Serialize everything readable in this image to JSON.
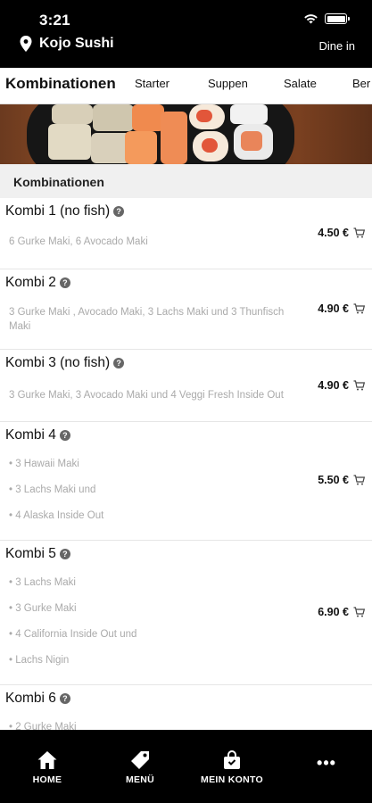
{
  "status_bar": {
    "time": "3:21"
  },
  "header": {
    "restaurant_name": "Kojo Sushi",
    "mode": "Dine in"
  },
  "tabs": [
    {
      "label": "Kombinationen",
      "active": true
    },
    {
      "label": "Starter",
      "active": false
    },
    {
      "label": "Suppen",
      "active": false
    },
    {
      "label": "Salate",
      "active": false
    },
    {
      "label": "Ber",
      "active": false
    }
  ],
  "section": {
    "title": "Kombinationen"
  },
  "items": [
    {
      "name": "Kombi 1 (no fish)",
      "description": "6 Gurke Maki, 6 Avocado Maki",
      "price": "4.50 €"
    },
    {
      "name": "Kombi 2",
      "description": "3 Gurke Maki , Avocado Maki, 3 Lachs Maki und 3 Thunfisch Maki",
      "price": "4.90 €"
    },
    {
      "name": "Kombi 3 (no fish)",
      "description": "3 Gurke Maki, 3 Avocado Maki und 4 Veggi Fresh Inside Out",
      "price": "4.90 €"
    },
    {
      "name": "Kombi 4",
      "lines": [
        "• 3 Hawaii Maki",
        "• 3 Lachs Maki und",
        "• 4 Alaska Inside Out"
      ],
      "price": "5.50 €"
    },
    {
      "name": "Kombi 5",
      "lines": [
        "• 3 Lachs Maki",
        "• 3 Gurke Maki",
        "• 4 California Inside Out und",
        "• Lachs Nigin"
      ],
      "price": "6.90 €"
    },
    {
      "name": "Kombi 6",
      "lines": [
        "• 2 Gurke Maki"
      ]
    }
  ],
  "bottom_nav": [
    {
      "label": "HOME",
      "icon": "home-icon"
    },
    {
      "label": "MENÜ",
      "icon": "tag-icon"
    },
    {
      "label": "MEIN KONTO",
      "icon": "shopping-bag-icon"
    },
    {
      "label": "•••",
      "icon": "more-icon"
    }
  ],
  "colors": {
    "header_bg": "#000000",
    "section_bg": "#f0f0f0",
    "muted_text": "#aaaaaa"
  }
}
